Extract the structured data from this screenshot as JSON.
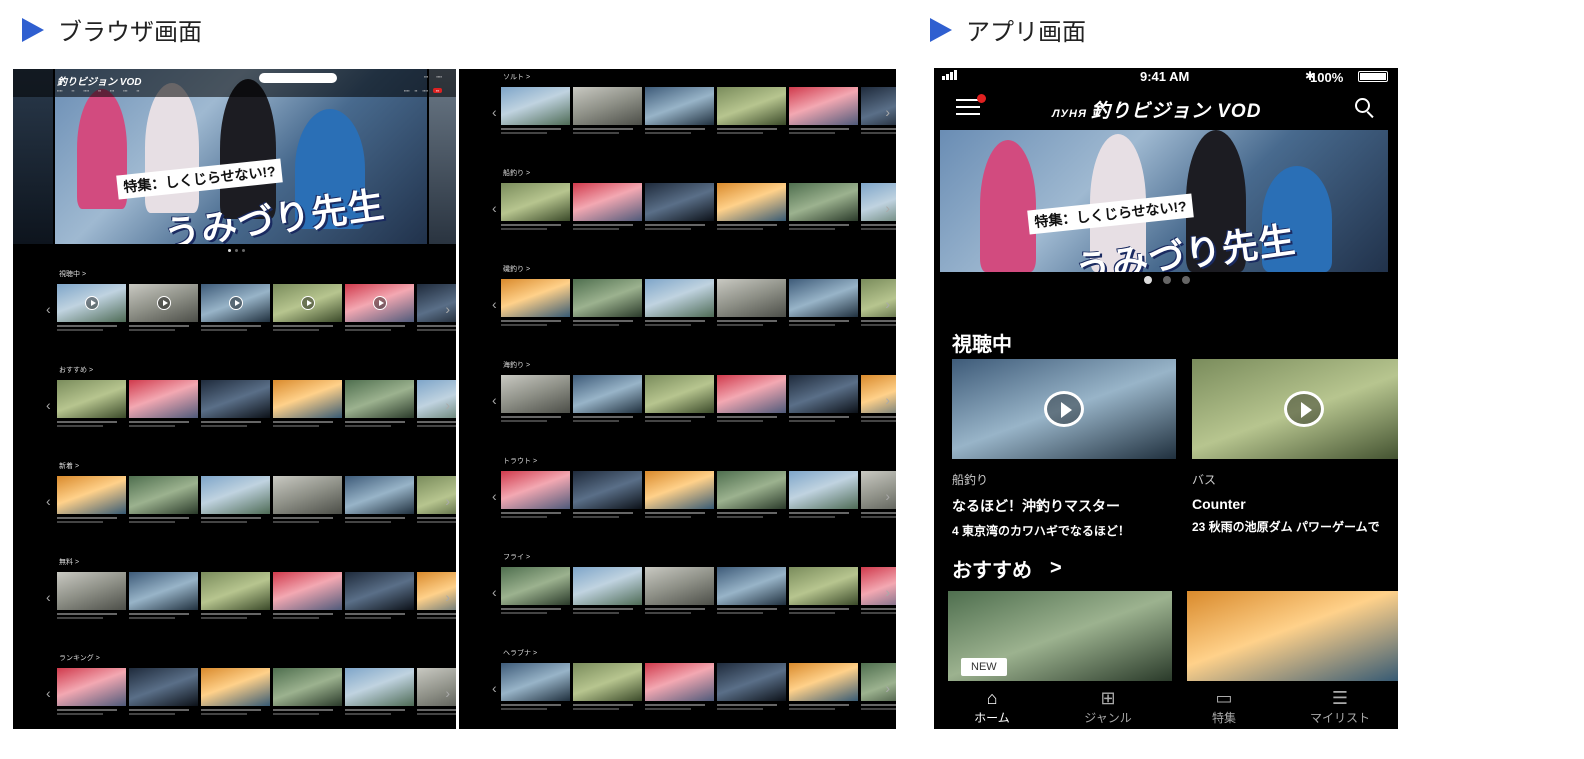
{
  "headings": {
    "browser": "ブラウザ画面",
    "app": "アプリ画面"
  },
  "colors": {
    "heading_triangle": "#2f5fd0",
    "notification_badge": "#e02020"
  },
  "browser": {
    "logo": "釣りビジョン VOD",
    "hero_tag": "特集：しくじらせない!?",
    "hero_title": "うみづり先生",
    "rows_left": [
      "視聴中 >",
      "おすすめ >",
      "新着 >",
      "無料 >",
      "ランキング >"
    ],
    "rows_right": [
      "ソルト >",
      "船釣り >",
      "磯釣り >",
      "海釣り >",
      "トラウト >",
      "フライ >",
      "ヘラブナ >"
    ]
  },
  "app": {
    "status": {
      "time": "9:41 AM",
      "battery": "100%"
    },
    "logo": "釣りビジョン VOD",
    "logo_mark": "ЛУНЯ",
    "icons": {
      "menu": "hamburger-icon",
      "search": "search-icon"
    },
    "hero_tag": "特集：しくじらせない!?",
    "hero_title": "うみづり先生",
    "hero_slide": "1 / 3",
    "watching_title": "視聴中",
    "watching": [
      {
        "genre": "船釣り",
        "title": "なるほど！沖釣りマスター",
        "episode": "4 東京湾のカワハギでなるほど！"
      },
      {
        "genre": "バス",
        "title": "Counter",
        "episode": "23 秋雨の池原ダム パワーゲームで"
      }
    ],
    "recommended_title": "おすすめ",
    "recommended_chevron": ">",
    "new_badge": "NEW",
    "tabs": [
      "ホーム",
      "ジャンル",
      "特集",
      "マイリスト"
    ],
    "active_tab": "ホーム"
  }
}
